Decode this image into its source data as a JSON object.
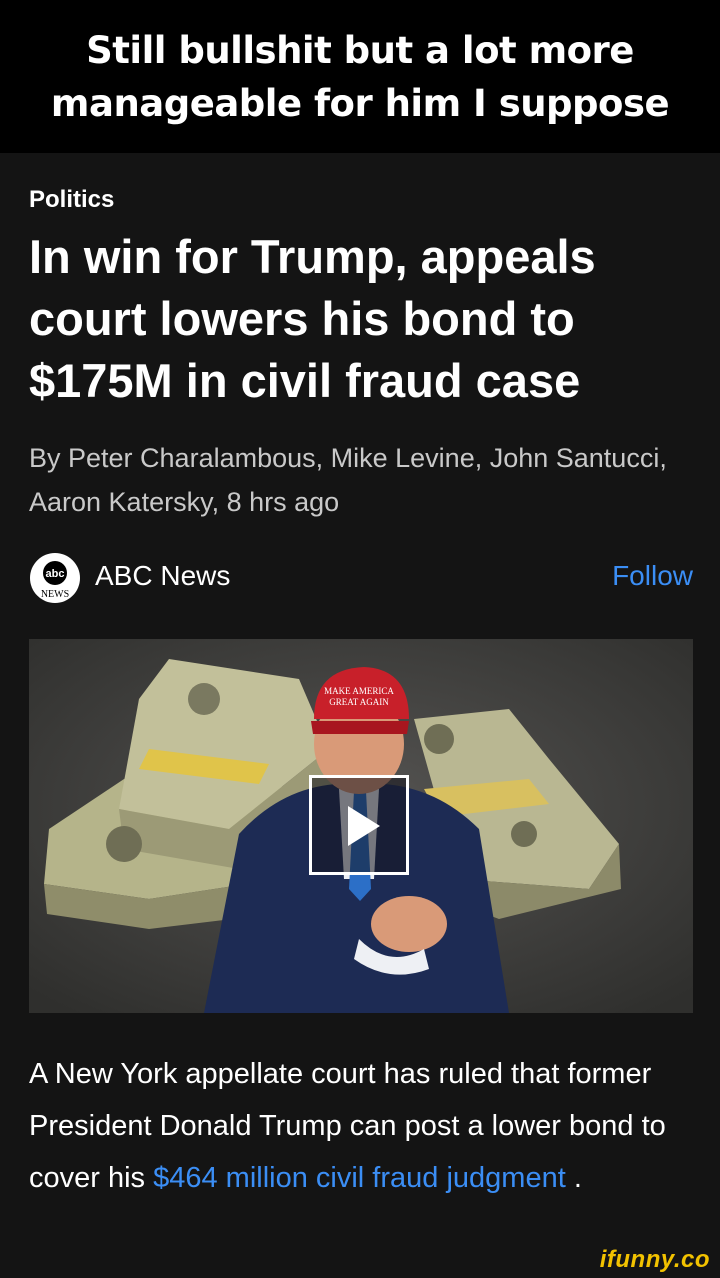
{
  "caption": "Still bullshit but a lot more manageable for him I suppose",
  "article": {
    "category": "Politics",
    "headline": "In win for Trump, appeals court lowers his bond to $175M in civil fraud case",
    "byline": "By Peter Charalambous, Mike Levine, John Santucci, Aaron Katersky, 8 hrs ago",
    "source": {
      "logo_top": "abc",
      "logo_bottom": "NEWS",
      "name": "ABC News",
      "follow_label": "Follow"
    },
    "media": {
      "hat_text_1": "MAKE AMERICA",
      "hat_text_2": "GREAT AGAIN",
      "play_icon": "play-icon"
    },
    "body": {
      "text_before": "A New York appellate court has ruled that former President Donald Trump can post a lower bond to cover his ",
      "link_text": "$464 million civil fraud judgment",
      "text_after": " ."
    }
  },
  "watermark": "ifunny.co",
  "colors": {
    "background": "#141414",
    "caption_bg": "#000000",
    "link": "#3b8ef5",
    "byline": "#c9c9c9",
    "watermark": "#f2c200"
  }
}
